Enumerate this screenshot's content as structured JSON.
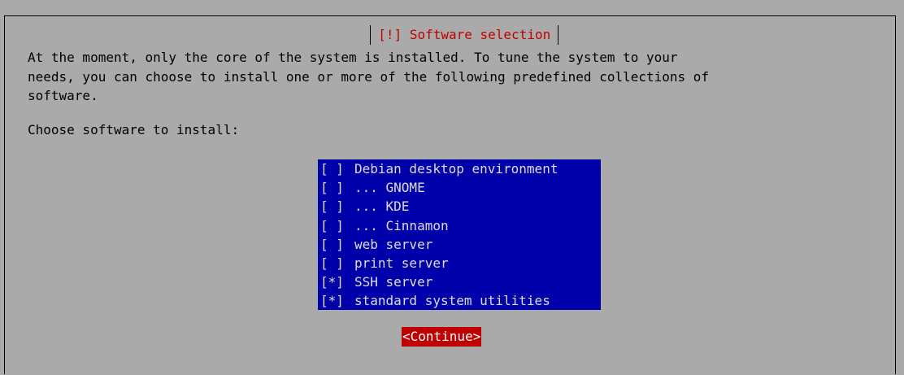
{
  "dialog": {
    "title": "[!] Software selection",
    "message_lines": [
      "At the moment, only the core of the system is installed. To tune the system to your",
      "needs, you can choose to install one or more of the following predefined collections of",
      "software."
    ],
    "prompt": "Choose software to install:",
    "items": [
      {
        "mark": "[ ]",
        "label": "Debian desktop environment"
      },
      {
        "mark": "[ ]",
        "label": "... GNOME"
      },
      {
        "mark": "[ ]",
        "label": "... KDE"
      },
      {
        "mark": "[ ]",
        "label": "... Cinnamon"
      },
      {
        "mark": "[ ]",
        "label": "web server"
      },
      {
        "mark": "[ ]",
        "label": "print server"
      },
      {
        "mark": "[*]",
        "label": "SSH server"
      },
      {
        "mark": "[*]",
        "label": "standard system utilities"
      }
    ],
    "continue_label": "<Continue>"
  },
  "colors": {
    "background": "#aaaaaa",
    "title": "#c00000",
    "list_background": "#0000aa",
    "list_text": "#dddddd",
    "button_background": "#c00000",
    "button_text": "#ffffff"
  }
}
